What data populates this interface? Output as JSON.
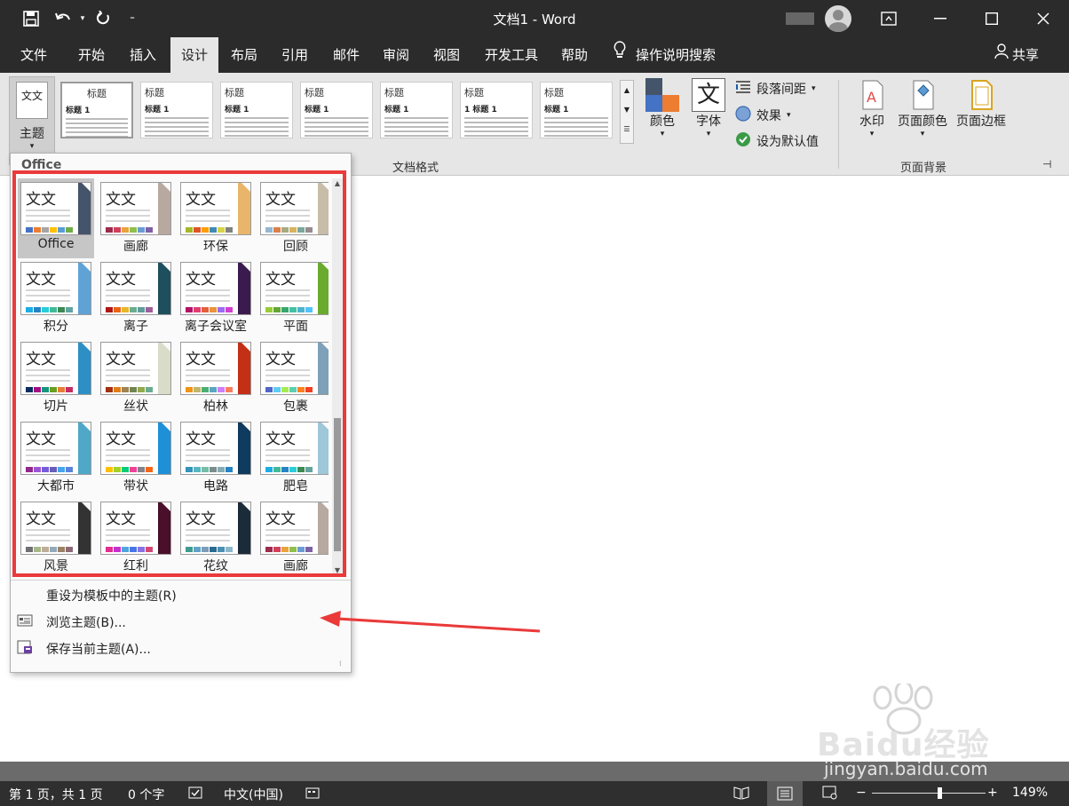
{
  "titlebar": {
    "title": "文档1 - Word",
    "save_icon": "save-icon",
    "undo_icon": "undo-icon",
    "redo_icon": "redo-icon",
    "customize_icon": "customize-qat-icon"
  },
  "tabs": [
    "文件",
    "开始",
    "插入",
    "设计",
    "布局",
    "引用",
    "邮件",
    "审阅",
    "视图",
    "开发工具",
    "帮助"
  ],
  "active_tab": "设计",
  "search": {
    "label": "操作说明搜索"
  },
  "share": {
    "label": "共享"
  },
  "ribbon": {
    "theme_button": {
      "label": "主题",
      "thumb_text": "文文"
    },
    "style_gallery": [
      {
        "head": "标题",
        "sub": "标题 1"
      },
      {
        "head": "标题",
        "sub": "标题 1"
      },
      {
        "head": "标题",
        "sub": "标题 1"
      },
      {
        "head": "标题",
        "sub": "标题 1"
      },
      {
        "head": "标题",
        "sub": "标题 1"
      },
      {
        "head": "标题",
        "sub": "1  标题 1"
      },
      {
        "head": "标题",
        "sub": "标题 1"
      }
    ],
    "colors_label": "颜色",
    "fonts_label": "字体",
    "fonts_glyph": "文",
    "paragraph_spacing_label": "段落间距",
    "effects_label": "效果",
    "set_default_label": "设为默认值",
    "doc_format_group": "文档格式",
    "watermark_label": "水印",
    "page_color_label": "页面颜色",
    "page_border_label": "页面边框",
    "page_bg_group": "页面背景"
  },
  "dropdown": {
    "header": "Office",
    "thumb_text": "文文",
    "themes": [
      {
        "name": "Office",
        "band": "#44546a",
        "swatches": [
          "#4472c4",
          "#ed7d31",
          "#a5a5a5",
          "#ffc000",
          "#5b9bd5",
          "#70ad47"
        ]
      },
      {
        "name": "画廊",
        "band": "#b8a9a0",
        "swatches": [
          "#9c2b4c",
          "#d1405b",
          "#e8a33b",
          "#8fbf4d",
          "#6a9bd6",
          "#7f5fa5"
        ]
      },
      {
        "name": "环保",
        "band": "#e8b56a",
        "swatches": [
          "#a6b727",
          "#df5327",
          "#fe9e00",
          "#418ab3",
          "#d7d447",
          "#818183"
        ]
      },
      {
        "name": "回顾",
        "band": "#c8bda8",
        "swatches": [
          "#94b6d2",
          "#dd8047",
          "#a5ab81",
          "#d8b25c",
          "#7ba79d",
          "#968c8c"
        ]
      },
      {
        "name": "积分",
        "band": "#5fa3d6",
        "swatches": [
          "#1cade4",
          "#2683c6",
          "#27ced7",
          "#42ba97",
          "#3e8853",
          "#62a39f"
        ]
      },
      {
        "name": "离子",
        "band": "#1e4f5e",
        "swatches": [
          "#b01513",
          "#ea6312",
          "#e6b729",
          "#6aac90",
          "#5f9c9d",
          "#9e5e9b"
        ]
      },
      {
        "name": "离子会议室",
        "band": "#3b1b4f",
        "swatches": [
          "#b31166",
          "#e33d6f",
          "#e45f3c",
          "#e9943a",
          "#9b6bf2",
          "#d53dd0"
        ]
      },
      {
        "name": "平面",
        "band": "#6aaa2e",
        "swatches": [
          "#99cb38",
          "#63a537",
          "#37a76f",
          "#44c1a3",
          "#4eb3cf",
          "#51c3f9"
        ]
      },
      {
        "name": "切片",
        "band": "#2d8fc4",
        "swatches": [
          "#052f61",
          "#a50e82",
          "#14967c",
          "#6a9e1f",
          "#e87d37",
          "#c62d64"
        ]
      },
      {
        "name": "丝状",
        "band": "#d8dcc8",
        "swatches": [
          "#a53010",
          "#de7e18",
          "#9f8351",
          "#728653",
          "#92aa4c",
          "#6aac91"
        ]
      },
      {
        "name": "柏林",
        "band": "#c33016",
        "swatches": [
          "#f09415",
          "#c1b56b",
          "#4baf73",
          "#5aa6c0",
          "#d17df9",
          "#fa7e5c"
        ]
      },
      {
        "name": "包裹",
        "band": "#7ea0b8",
        "swatches": [
          "#4e67c8",
          "#5eccf3",
          "#a7ea52",
          "#5dceaf",
          "#ff8021",
          "#f14124"
        ]
      },
      {
        "name": "大都市",
        "band": "#4fa8c8",
        "swatches": [
          "#92278f",
          "#9b57d3",
          "#755dd9",
          "#665eb8",
          "#45a5ed",
          "#5982db"
        ]
      },
      {
        "name": "带状",
        "band": "#1e90d8",
        "swatches": [
          "#ffc000",
          "#a5d028",
          "#08cc78",
          "#f24099",
          "#828288",
          "#f56617"
        ]
      },
      {
        "name": "电路",
        "band": "#0f3b5e",
        "swatches": [
          "#3494ba",
          "#58b6c0",
          "#75bda7",
          "#7a8c8e",
          "#84acb6",
          "#2683c6"
        ]
      },
      {
        "name": "肥皂",
        "band": "#9ec7d8",
        "swatches": [
          "#1cade4",
          "#42ba97",
          "#2683c6",
          "#27ced7",
          "#3e8853",
          "#62a39f"
        ]
      },
      {
        "name": "风景",
        "band": "#333333",
        "swatches": [
          "#6f6f74",
          "#a7b789",
          "#beae98",
          "#92a9b9",
          "#9c8265",
          "#8d6974"
        ]
      },
      {
        "name": "红利",
        "band": "#4a0f2a",
        "swatches": [
          "#e32d91",
          "#c830cc",
          "#4ea6dc",
          "#4775e7",
          "#8971e1",
          "#d54773"
        ]
      },
      {
        "name": "花纹",
        "band": "#1c2b3a",
        "swatches": [
          "#3e9c8f",
          "#5fa3c6",
          "#7d9cb8",
          "#2b6b8f",
          "#4d8fb3",
          "#8cb8cc"
        ]
      },
      {
        "name": "画廊",
        "band": "#b8a9a0",
        "swatches": [
          "#9c2b4c",
          "#d1405b",
          "#e8a33b",
          "#8fbf4d",
          "#6a9bd6",
          "#7f5fa5"
        ]
      }
    ],
    "reset_label": "重设为模板中的主题(R)",
    "browse_label": "浏览主题(B)...",
    "save_label": "保存当前主题(A)..."
  },
  "statusbar": {
    "page": "第 1 页，共 1 页",
    "words": "0 个字",
    "language": "中文(中国)",
    "zoom": "149%",
    "zoom_fraction": 0.6
  },
  "watermark": {
    "brand": "Baidu经验",
    "url": "jingyan.baidu.com"
  },
  "colors": {
    "title_bg": "#2b2b2b",
    "ribbon_bg": "#e6e6e6",
    "annotation_red": "#ea3a3a"
  }
}
